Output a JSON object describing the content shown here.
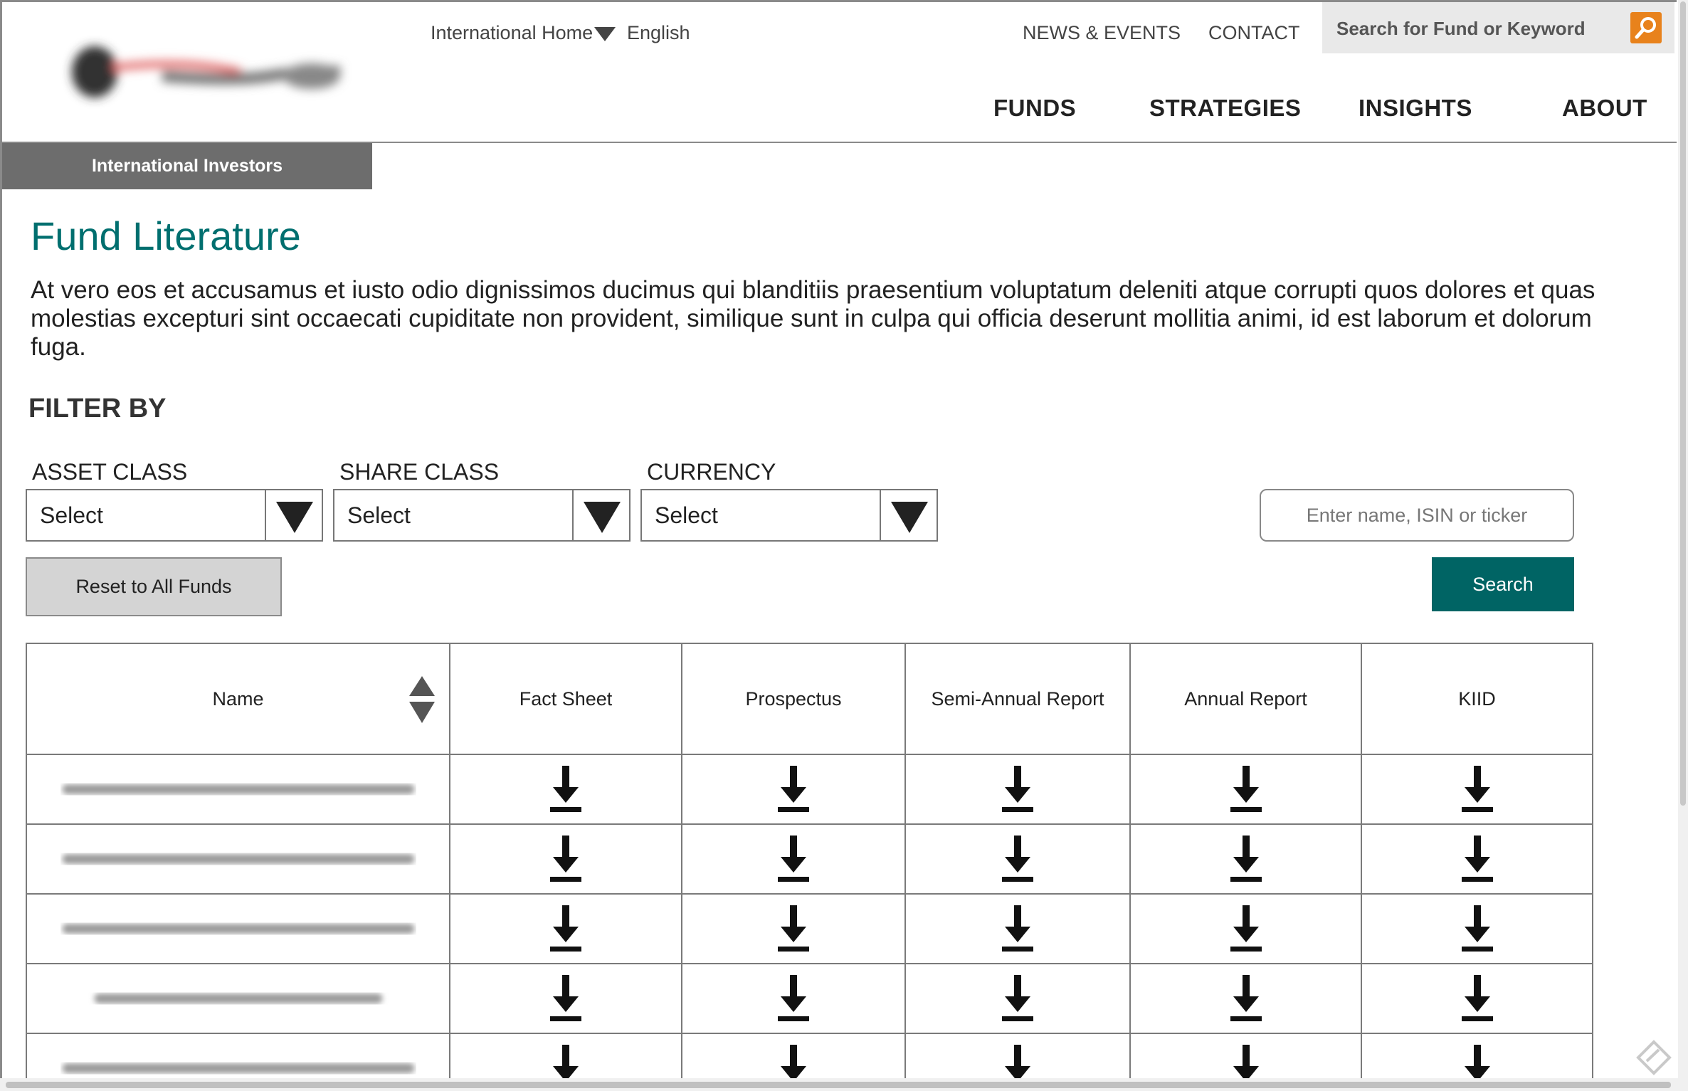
{
  "header": {
    "locale_menu": "International Home",
    "language": "English",
    "top_links": [
      "NEWS & EVENTS",
      "CONTACT"
    ],
    "search_placeholder": "Search for Fund or Keyword",
    "main_nav": [
      "FUNDS",
      "STRATEGIES",
      "INSIGHTS",
      "ABOUT"
    ],
    "section_tab": "International Investors"
  },
  "page": {
    "title": "Fund Literature",
    "intro": "At vero eos et accusamus et iusto odio dignissimos ducimus qui blanditiis praesentium voluptatum deleniti atque corrupti quos dolores et quas molestias excepturi sint occaecati cupiditate non provident, similique sunt in culpa qui officia deserunt mollitia animi, id est laborum et dolorum fuga."
  },
  "filters": {
    "heading": "FILTER BY",
    "asset_class": {
      "label": "ASSET CLASS",
      "value": "Select"
    },
    "share_class": {
      "label": "SHARE CLASS",
      "value": "Select"
    },
    "currency": {
      "label": "CURRENCY",
      "value": "Select"
    },
    "search_placeholder": "Enter name, ISIN or ticker",
    "reset_label": "Reset to All Funds",
    "search_label": "Search"
  },
  "table": {
    "columns": [
      "Name",
      "Fact Sheet",
      "Prospectus",
      "Semi-Annual Report",
      "Annual Report",
      "KIID"
    ],
    "row_count_visible": 5
  },
  "colors": {
    "accent_teal": "#006f6f",
    "search_button": "#006464",
    "search_icon_bg": "#e8821c",
    "tab_gray": "#6d6d6d"
  },
  "icons": {
    "download": "download-arrow-icon",
    "sort": "sort-updown-icon",
    "search": "magnifier-icon",
    "dropdown": "triangle-down-icon"
  }
}
